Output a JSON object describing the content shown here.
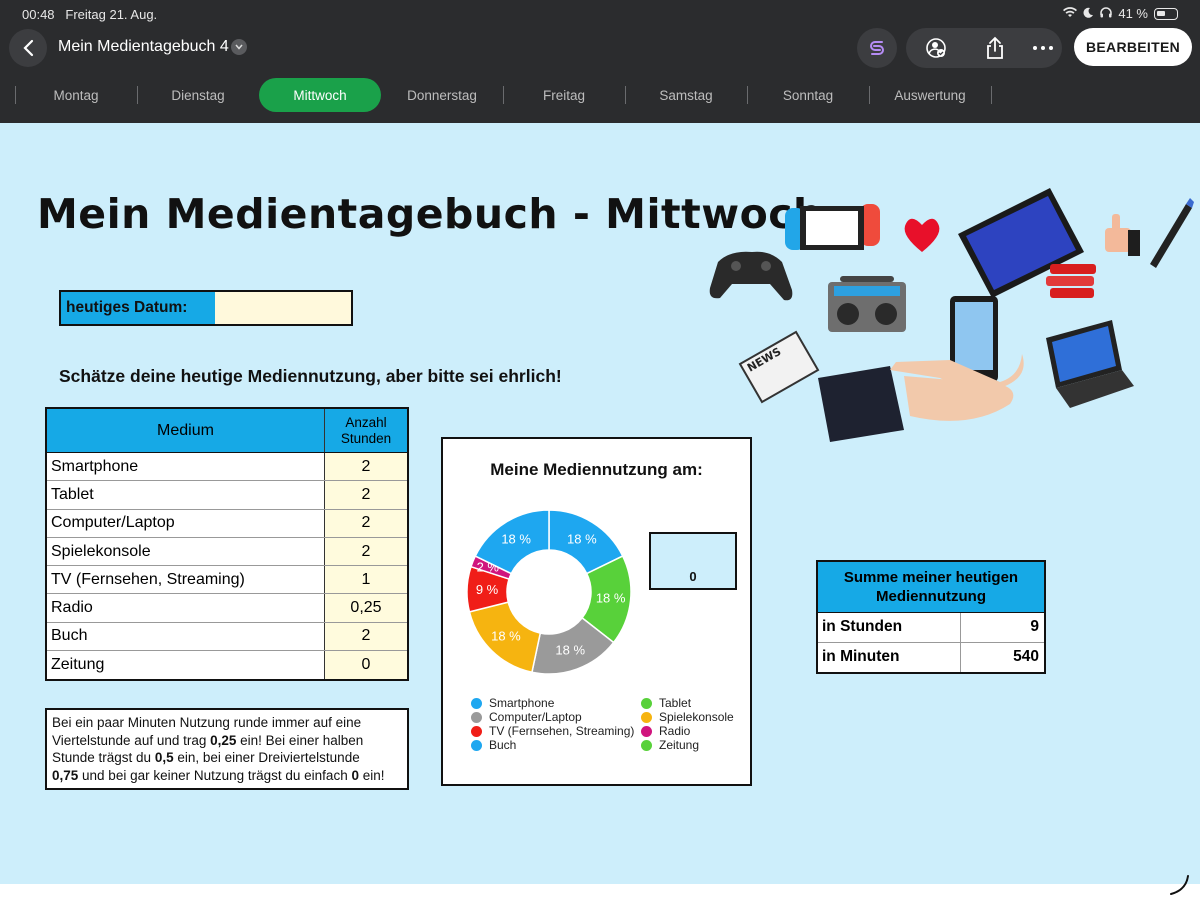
{
  "status": {
    "time": "00:48",
    "date": "Freitag 21. Aug.",
    "battery": "41 %"
  },
  "toolbar": {
    "title": "Mein Medientagebuch 4",
    "edit_label": "BEARBEITEN"
  },
  "tabs": [
    {
      "label": "Montag"
    },
    {
      "label": "Dienstag"
    },
    {
      "label": "Mittwoch",
      "active": true
    },
    {
      "label": "Donnerstag"
    },
    {
      "label": "Freitag"
    },
    {
      "label": "Samstag"
    },
    {
      "label": "Sonntag"
    },
    {
      "label": "Auswertung"
    }
  ],
  "sheet": {
    "title": "Mein Medientagebuch - Mittwoch",
    "date_label": "heutiges Datum:",
    "date_value": "",
    "instruction": "Schätze deine heutige Mediennutzung, aber bitte sei ehrlich!",
    "table": {
      "col_medium": "Medium",
      "col_hours": "Anzahl Stunden",
      "rows": [
        {
          "medium": "Smartphone",
          "hours": "2"
        },
        {
          "medium": "Tablet",
          "hours": "2"
        },
        {
          "medium": "Computer/Laptop",
          "hours": "2"
        },
        {
          "medium": "Spielekonsole",
          "hours": "2"
        },
        {
          "medium": "TV (Fernsehen, Streaming)",
          "hours": "1"
        },
        {
          "medium": "Radio",
          "hours": "0,25"
        },
        {
          "medium": "Buch",
          "hours": "2"
        },
        {
          "medium": "Zeitung",
          "hours": "0"
        }
      ]
    },
    "note": {
      "p1": "Bei ein paar Minuten Nutzung runde immer auf eine Viertelstunde auf und trag ",
      "b1": "0,25",
      "p2": " ein! Bei einer halben Stunde trägst du ",
      "b2": "0,5",
      "p3": " ein, bei einer Dreiviertelstunde ",
      "b3": "0,75",
      "p4": " und bei gar keiner Nutzung trägst du einfach ",
      "b4": "0",
      "p5": " ein!"
    },
    "chart_date_value": "0",
    "sum": {
      "title": "Summe meiner heutigen Mediennutzung",
      "hours_label": "in Stunden",
      "hours_value": "9",
      "minutes_label": "in Minuten",
      "minutes_value": "540"
    }
  },
  "colors": {
    "smartphone": "#1ea7f0",
    "tablet": "#58d13a",
    "computer": "#9a9a9a",
    "konsole": "#f6b410",
    "tv": "#f01e18",
    "radio": "#d0157e",
    "buch": "#1ea7f0",
    "zeitung": "#58d13a"
  },
  "chart_data": {
    "type": "pie",
    "title": "Meine Mediennutzung am:",
    "categories": [
      "Smartphone",
      "Tablet",
      "Computer/Laptop",
      "Spielekonsole",
      "TV (Fernsehen, Streaming)",
      "Radio",
      "Buch",
      "Zeitung"
    ],
    "values": [
      2,
      2,
      2,
      2,
      1,
      0.25,
      2,
      0
    ],
    "labels": [
      "18 %",
      "18 %",
      "18 %",
      "18 %",
      "9 %",
      "2 %",
      "18 %",
      ""
    ],
    "legend_order": [
      "Smartphone",
      "Tablet",
      "Computer/Laptop",
      "Spielekonsole",
      "TV (Fernsehen, Streaming)",
      "Radio",
      "Buch",
      "Zeitung"
    ],
    "legend_position": "bottom"
  }
}
